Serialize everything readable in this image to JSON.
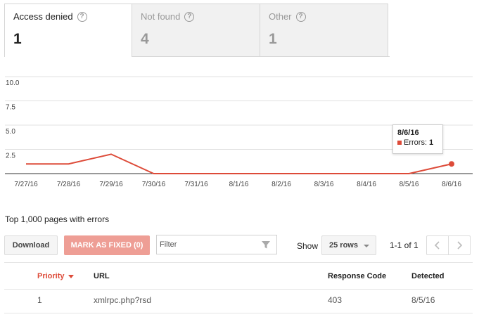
{
  "tabs": [
    {
      "label": "Access denied",
      "count": "1",
      "active": true
    },
    {
      "label": "Not found",
      "count": "4",
      "active": false
    },
    {
      "label": "Other",
      "count": "1",
      "active": false
    }
  ],
  "chart_data": {
    "type": "line",
    "categories": [
      "7/27/16",
      "7/28/16",
      "7/29/16",
      "7/30/16",
      "7/31/16",
      "8/1/16",
      "8/2/16",
      "8/3/16",
      "8/4/16",
      "8/5/16",
      "8/6/16"
    ],
    "series": [
      {
        "name": "Errors",
        "values": [
          1,
          1,
          2,
          0,
          0,
          0,
          0,
          0,
          0,
          0,
          1
        ],
        "color": "#dd4b39"
      }
    ],
    "yticks": [
      "10.0",
      "7.5",
      "5.0",
      "2.5"
    ],
    "ylim": [
      0,
      10
    ],
    "grid": true
  },
  "tooltip": {
    "date": "8/6/16",
    "label": "Errors:",
    "value": "1"
  },
  "section_title": "Top 1,000 pages with errors",
  "toolbar": {
    "download": "Download",
    "mark_fixed": "MARK AS FIXED (0)",
    "filter_placeholder": "Filter",
    "show_label": "Show",
    "rows_select": "25 rows",
    "pager_text": "1-1 of 1"
  },
  "table": {
    "headers": {
      "priority": "Priority",
      "url": "URL",
      "response": "Response Code",
      "detected": "Detected"
    },
    "rows": [
      {
        "priority": "1",
        "url": "xmlrpc.php?rsd",
        "response": "403",
        "detected": "8/5/16"
      }
    ]
  }
}
